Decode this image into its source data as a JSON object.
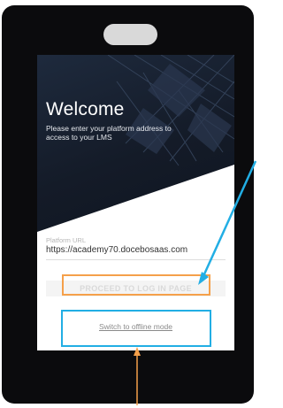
{
  "login_screen": {
    "title": "Welcome",
    "subtitle": "Please enter your platform address to access to your LMS",
    "platform_url": {
      "label": "Platform URL",
      "value": "https://academy70.docebosaas.com"
    },
    "proceed_button": "PROCEED TO LOG IN PAGE",
    "offline_link": "Switch to offline mode"
  },
  "colors": {
    "device_frame": "#0b0b0d",
    "hero_background": "#1a2333",
    "annotation_blue": "#22aee4",
    "annotation_orange": "#f5a04a",
    "button_disabled_bg": "#f4f4f4",
    "button_disabled_text": "#d9d9d9"
  },
  "annotations": [
    {
      "name": "proceed-highlight",
      "color": "orange",
      "target": "proceed_button"
    },
    {
      "name": "offline-highlight",
      "color": "blue",
      "target": "offline_link"
    }
  ]
}
